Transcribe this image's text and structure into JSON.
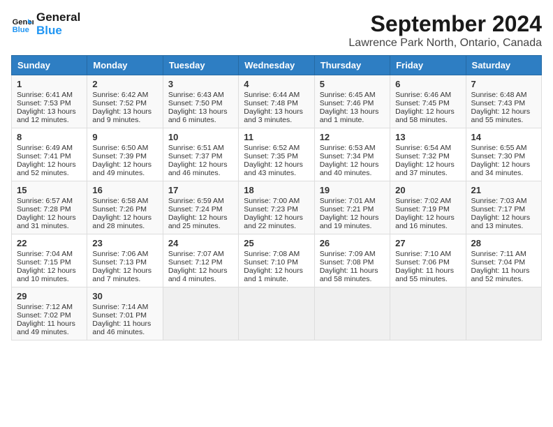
{
  "header": {
    "logo_line1": "General",
    "logo_line2": "Blue",
    "month": "September 2024",
    "location": "Lawrence Park North, Ontario, Canada"
  },
  "weekdays": [
    "Sunday",
    "Monday",
    "Tuesday",
    "Wednesday",
    "Thursday",
    "Friday",
    "Saturday"
  ],
  "weeks": [
    [
      {
        "day": "1",
        "sunrise": "6:41 AM",
        "sunset": "7:53 PM",
        "daylight": "13 hours and 12 minutes."
      },
      {
        "day": "2",
        "sunrise": "6:42 AM",
        "sunset": "7:52 PM",
        "daylight": "13 hours and 9 minutes."
      },
      {
        "day": "3",
        "sunrise": "6:43 AM",
        "sunset": "7:50 PM",
        "daylight": "13 hours and 6 minutes."
      },
      {
        "day": "4",
        "sunrise": "6:44 AM",
        "sunset": "7:48 PM",
        "daylight": "13 hours and 3 minutes."
      },
      {
        "day": "5",
        "sunrise": "6:45 AM",
        "sunset": "7:46 PM",
        "daylight": "13 hours and 1 minute."
      },
      {
        "day": "6",
        "sunrise": "6:46 AM",
        "sunset": "7:45 PM",
        "daylight": "12 hours and 58 minutes."
      },
      {
        "day": "7",
        "sunrise": "6:48 AM",
        "sunset": "7:43 PM",
        "daylight": "12 hours and 55 minutes."
      }
    ],
    [
      {
        "day": "8",
        "sunrise": "6:49 AM",
        "sunset": "7:41 PM",
        "daylight": "12 hours and 52 minutes."
      },
      {
        "day": "9",
        "sunrise": "6:50 AM",
        "sunset": "7:39 PM",
        "daylight": "12 hours and 49 minutes."
      },
      {
        "day": "10",
        "sunrise": "6:51 AM",
        "sunset": "7:37 PM",
        "daylight": "12 hours and 46 minutes."
      },
      {
        "day": "11",
        "sunrise": "6:52 AM",
        "sunset": "7:35 PM",
        "daylight": "12 hours and 43 minutes."
      },
      {
        "day": "12",
        "sunrise": "6:53 AM",
        "sunset": "7:34 PM",
        "daylight": "12 hours and 40 minutes."
      },
      {
        "day": "13",
        "sunrise": "6:54 AM",
        "sunset": "7:32 PM",
        "daylight": "12 hours and 37 minutes."
      },
      {
        "day": "14",
        "sunrise": "6:55 AM",
        "sunset": "7:30 PM",
        "daylight": "12 hours and 34 minutes."
      }
    ],
    [
      {
        "day": "15",
        "sunrise": "6:57 AM",
        "sunset": "7:28 PM",
        "daylight": "12 hours and 31 minutes."
      },
      {
        "day": "16",
        "sunrise": "6:58 AM",
        "sunset": "7:26 PM",
        "daylight": "12 hours and 28 minutes."
      },
      {
        "day": "17",
        "sunrise": "6:59 AM",
        "sunset": "7:24 PM",
        "daylight": "12 hours and 25 minutes."
      },
      {
        "day": "18",
        "sunrise": "7:00 AM",
        "sunset": "7:23 PM",
        "daylight": "12 hours and 22 minutes."
      },
      {
        "day": "19",
        "sunrise": "7:01 AM",
        "sunset": "7:21 PM",
        "daylight": "12 hours and 19 minutes."
      },
      {
        "day": "20",
        "sunrise": "7:02 AM",
        "sunset": "7:19 PM",
        "daylight": "12 hours and 16 minutes."
      },
      {
        "day": "21",
        "sunrise": "7:03 AM",
        "sunset": "7:17 PM",
        "daylight": "12 hours and 13 minutes."
      }
    ],
    [
      {
        "day": "22",
        "sunrise": "7:04 AM",
        "sunset": "7:15 PM",
        "daylight": "12 hours and 10 minutes."
      },
      {
        "day": "23",
        "sunrise": "7:06 AM",
        "sunset": "7:13 PM",
        "daylight": "12 hours and 7 minutes."
      },
      {
        "day": "24",
        "sunrise": "7:07 AM",
        "sunset": "7:12 PM",
        "daylight": "12 hours and 4 minutes."
      },
      {
        "day": "25",
        "sunrise": "7:08 AM",
        "sunset": "7:10 PM",
        "daylight": "12 hours and 1 minute."
      },
      {
        "day": "26",
        "sunrise": "7:09 AM",
        "sunset": "7:08 PM",
        "daylight": "11 hours and 58 minutes."
      },
      {
        "day": "27",
        "sunrise": "7:10 AM",
        "sunset": "7:06 PM",
        "daylight": "11 hours and 55 minutes."
      },
      {
        "day": "28",
        "sunrise": "7:11 AM",
        "sunset": "7:04 PM",
        "daylight": "11 hours and 52 minutes."
      }
    ],
    [
      {
        "day": "29",
        "sunrise": "7:12 AM",
        "sunset": "7:02 PM",
        "daylight": "11 hours and 49 minutes."
      },
      {
        "day": "30",
        "sunrise": "7:14 AM",
        "sunset": "7:01 PM",
        "daylight": "11 hours and 46 minutes."
      },
      null,
      null,
      null,
      null,
      null
    ]
  ]
}
